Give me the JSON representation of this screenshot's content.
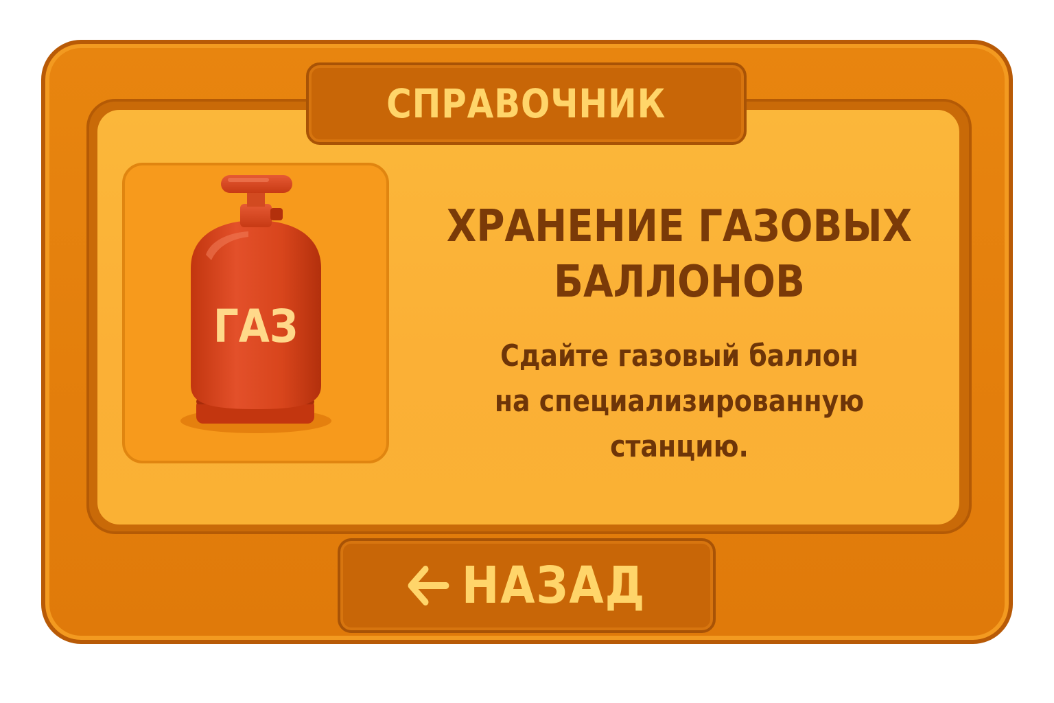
{
  "header": {
    "title": "СПРАВОЧНИК"
  },
  "item": {
    "icon": "gas-cylinder-icon",
    "icon_label": "ГАЗ",
    "title_line1": "ХРАНЕНИЕ ГАЗОВЫХ",
    "title_line2": "БАЛЛОНОВ",
    "text_line1": "Сдайте газовый баллон",
    "text_line2": "на специализированную",
    "text_line3": "станцию."
  },
  "back_button": {
    "icon": "arrow-left-icon",
    "label": "НАЗАД"
  },
  "colors": {
    "frame": "#e07a0a",
    "panel": "#fbb036",
    "plate": "#c86607",
    "accent_text": "#ffd56a",
    "dark_text": "#7a3a08",
    "cylinder": "#d8451c"
  }
}
